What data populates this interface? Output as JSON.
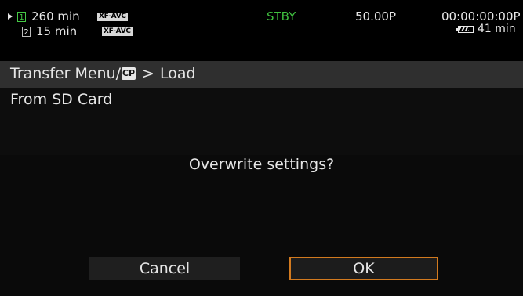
{
  "status": {
    "slot1": {
      "number": "1",
      "remaining": "260 min",
      "format": "XF-AVC",
      "active": true
    },
    "slot2": {
      "number": "2",
      "remaining": "15 min",
      "format": "XF-AVC",
      "active": false
    },
    "mode": "STBY",
    "frame_rate": "50.00P",
    "timecode": "00:00:00:00P",
    "battery": {
      "remaining": "41 min",
      "level_fraction": 0.75
    },
    "icons": [
      "play-indicator-icon",
      "battery-icon",
      "custom-picture-icon"
    ],
    "colors": {
      "standby": "#3fbf3f",
      "active_slot": "#45c845",
      "focus_border": "#d27a1f"
    }
  },
  "menu": {
    "title_prefix": "Transfer Menu/",
    "title_icon_text": "CP",
    "title_separator": ">",
    "title_suffix": "Load",
    "source": "From SD Card"
  },
  "dialog": {
    "prompt": "Overwrite settings?",
    "cancel_label": "Cancel",
    "ok_label": "OK",
    "focused": "OK"
  }
}
